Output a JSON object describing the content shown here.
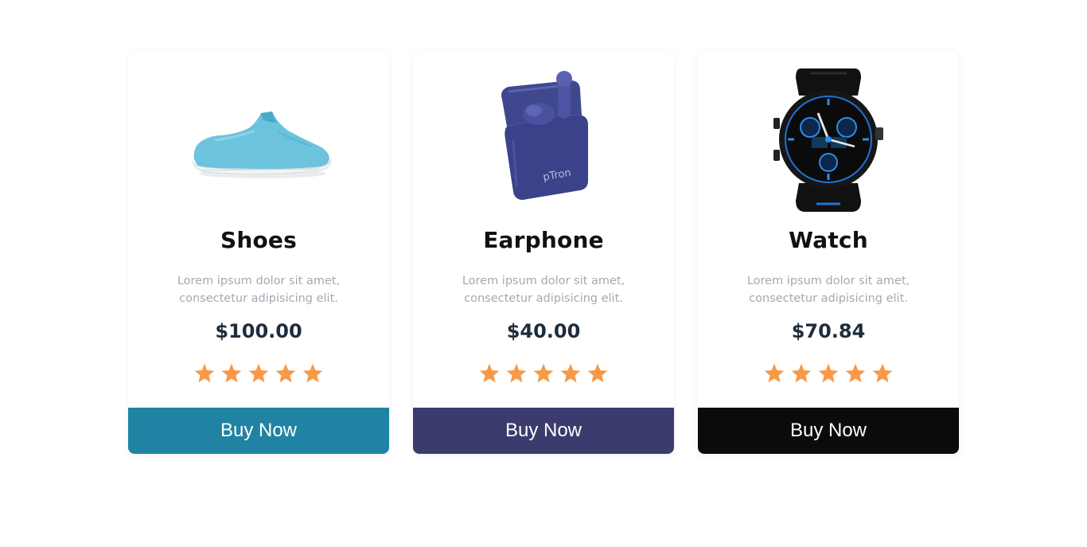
{
  "products": [
    {
      "name": "Shoes",
      "description": "Lorem ipsum dolor sit amet, consectetur adipisicing elit.",
      "price": "$100.00",
      "rating": 5,
      "button_label": "Buy Now",
      "button_color": "#2183a4",
      "image_icon": "shoe-icon"
    },
    {
      "name": "Earphone",
      "description": "Lorem ipsum dolor sit amet, consectetur adipisicing elit.",
      "price": "$40.00",
      "rating": 5,
      "button_label": "Buy Now",
      "button_color": "#3c3b6e",
      "image_icon": "earphone-icon",
      "image_brand_text": "pTron"
    },
    {
      "name": "Watch",
      "description": "Lorem ipsum dolor sit amet, consectetur adipisicing elit.",
      "price": "$70.84",
      "rating": 5,
      "button_label": "Buy Now",
      "button_color": "#0b0b0b",
      "image_icon": "watch-icon"
    }
  ],
  "colors": {
    "star": "#f7994a",
    "title": "#111111",
    "description": "#a2aab3",
    "price": "#1e2d3d"
  }
}
